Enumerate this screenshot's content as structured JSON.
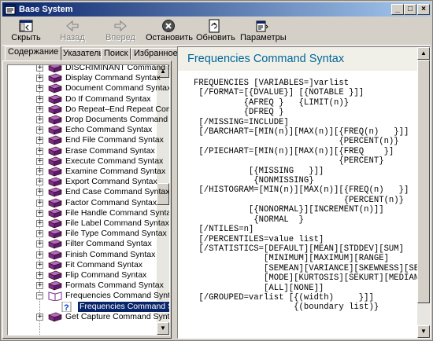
{
  "window": {
    "title": "Base System",
    "controls": [
      "_",
      "□",
      "×"
    ]
  },
  "toolbar": {
    "hide": "Скрыть",
    "back": "Назад",
    "forward": "Вперед",
    "stop": "Остановить",
    "refresh": "Обновить",
    "options": "Параметры"
  },
  "tabs": [
    "Содержание",
    "Указатель",
    "Поиск",
    "Избранное"
  ],
  "tree": {
    "items": [
      "DISCRIMINANT Command Syntax",
      "Display Command Syntax",
      "Document Command Syntax",
      "Do If Command Syntax",
      "Do Repeat–End Repeat Command",
      "Drop Documents Command Syntax",
      "Echo Command Syntax",
      "End File Command Syntax",
      "Erase Command Syntax",
      "Execute Command Syntax",
      "Examine Command Syntax",
      "Export Command Syntax",
      "End Case Command Syntax",
      "Factor Command Syntax",
      "File Handle Command Syntax",
      "File Label Command Syntax",
      "File Type Command Syntax",
      "Filter Command Syntax",
      "Finish Command Syntax",
      "Fit Command Syntax",
      "Flip Command Syntax",
      "Formats Command Syntax",
      "Frequencies Command Syntax"
    ],
    "selected_child": "Frequencies Command Syntax",
    "last_item": "Get Capture Command Syntax"
  },
  "doc": {
    "title": "Frequencies Command Syntax",
    "code": "FREQUENCIES [VARIABLES=]varlist\n [/FORMAT=[{DVALUE}] [{NOTABLE }]]\n          {AFREQ }   {LIMIT(n)}\n          {DFREQ }\n [/MISSING=INCLUDE]\n [/BARCHART=[MIN(n)][MAX(n)][{FREQ(n)   }]]\n                             {PERCENT(n)}\n [/PIECHART=[MIN(n)][MAX(n)][{FREQ    }]\n                             {PERCENT}\n           [{MISSING   }]]\n            {NONMISSING}\n [/HISTOGRAM=[MIN(n)][MAX(n)][{FREQ(n)   }]\n                              {PERCENT(n)}\n           [{NONORMAL}][INCREMENT(n)]]\n            {NORMAL  }\n [/NTILES=n]\n [/PERCENTILES=value list]\n [/STATISTICS=[DEFAULT][MEAN][STDDEV][SUM]\n              [MINIMUM][MAXIMUM][RANGE]\n              [SEMEAN][VARIANCE][SKEWNESS][SESKEW]\n              [MODE][KURTOSIS][SEKURT][MEDIAN]\n              [ALL][NONE]]\n [/GROUPED=varlist [{(width)     }]]\n                    {(boundary list)}"
  },
  "colors": {
    "title_bar": "#0a246a",
    "doc_title": "#006699",
    "book_icon": "#7a2f8f"
  }
}
